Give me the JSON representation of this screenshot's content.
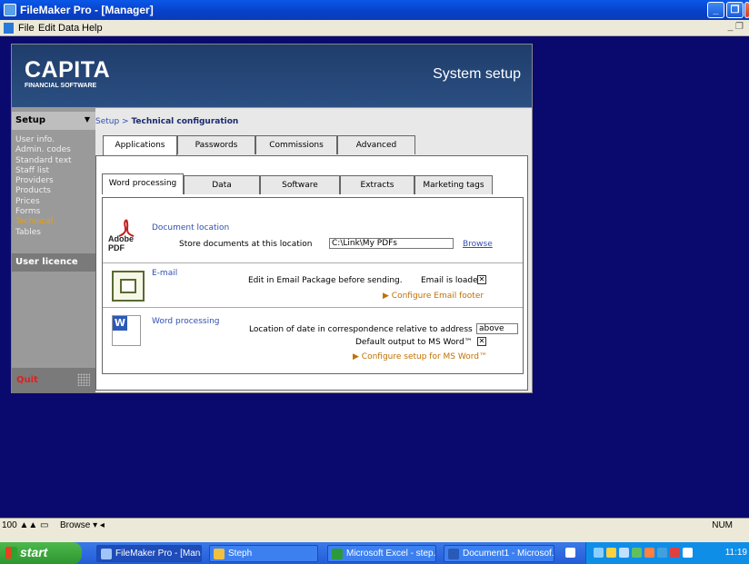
{
  "window": {
    "title": "FileMaker Pro - [Manager]"
  },
  "menu": {
    "items": [
      "File",
      "Edit",
      "Data",
      "Help"
    ]
  },
  "banner": {
    "logo": "CAPITA",
    "logo_sub": "FINANCIAL SOFTWARE",
    "title": "System setup"
  },
  "sidebar": {
    "header": "Setup",
    "items": [
      "User info.",
      "Admin. codes",
      "Standard text",
      "Staff list",
      "Providers",
      "Products",
      "Prices",
      "Forms",
      "Technical",
      "Tables"
    ],
    "active": "Technical",
    "licence": "User licence",
    "quit": "Quit"
  },
  "breadcrumb": {
    "root": "Setup >",
    "current": "Technical configuration"
  },
  "tabs_top": [
    "Applications",
    "Passwords",
    "Commissions",
    "Advanced"
  ],
  "tabs_sub": [
    "Word processing",
    "Data",
    "Software",
    "Extracts",
    "Marketing tags"
  ],
  "document": {
    "icon_text": "Adobe PDF",
    "title": "Document location",
    "label": "Store documents at this location",
    "value": "C:\\Link\\My PDFs",
    "browse": "Browse"
  },
  "email": {
    "title": "E-mail",
    "label": "Edit in Email Package before sending.",
    "loaded_label": "Email is loaded",
    "loaded_checked": true,
    "footer_link": "Configure Email footer"
  },
  "wordproc": {
    "title": "Word processing",
    "date_label": "Location of date in correspondence relative to address",
    "date_value": "above",
    "default_label": "Default output to MS Word™",
    "default_checked": true,
    "config_link": "Configure setup for MS Word™"
  },
  "status": {
    "zoom": "100",
    "mode": "Browse",
    "num": "NUM"
  },
  "taskbar": {
    "start": "start",
    "items": [
      "FileMaker Pro - [Mana...",
      "Steph",
      "Microsoft Excel - step...",
      "Document1 - Microsof..."
    ],
    "clock": "11:19"
  }
}
